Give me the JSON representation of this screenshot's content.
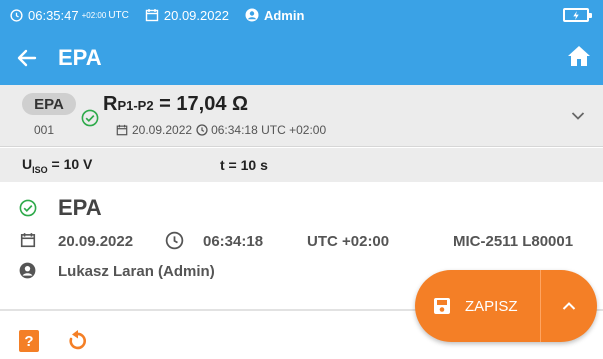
{
  "status_bar": {
    "time": "06:35:47",
    "tz": "+02:00",
    "utc": "UTC",
    "date": "20.09.2022",
    "user": "Admin",
    "battery_icon": "battery-charging-icon"
  },
  "header": {
    "title": "EPA",
    "back_icon": "back-arrow-icon",
    "home_icon": "home-icon"
  },
  "result": {
    "badge": "EPA",
    "number": "001",
    "main_r": "R",
    "main_sub": "P1-P2",
    "main_value": " = 17,04 Ω",
    "date": "20.09.2022",
    "time": "06:34:18 UTC +02:00"
  },
  "params": {
    "uiso_label": "U",
    "uiso_sub": "ISO",
    "uiso_value": " = 10 V",
    "t": "t = 10 s"
  },
  "details": {
    "title": "EPA",
    "date": "20.09.2022",
    "time": "06:34:18",
    "tz": "UTC +02:00",
    "device": "MIC-2511 L80001",
    "user": "Lukasz Laran (Admin)"
  },
  "actions": {
    "save_label": "ZAPISZ",
    "help_label": "?"
  },
  "colors": {
    "primary": "#3aa2e6",
    "accent": "#f47f26",
    "success": "#2eaa4a"
  }
}
